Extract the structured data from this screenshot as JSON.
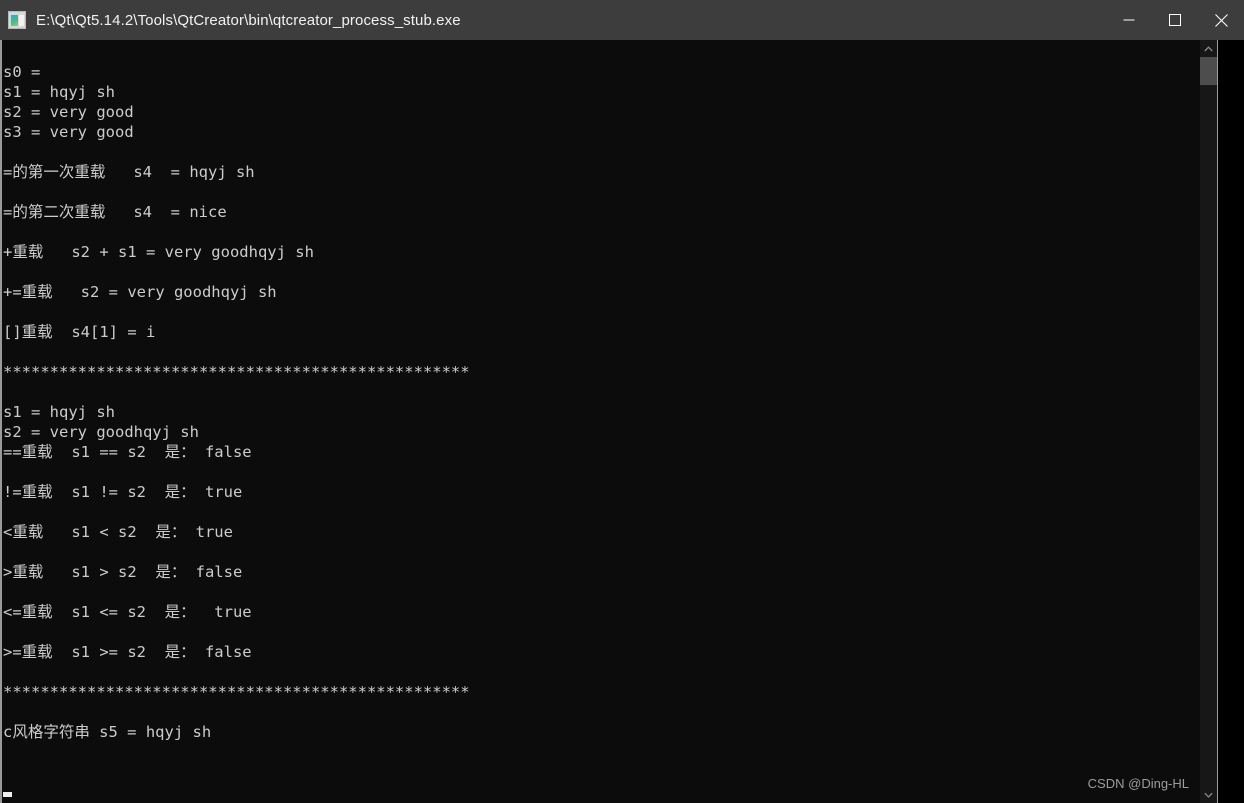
{
  "window": {
    "title": "E:\\Qt\\Qt5.14.2\\Tools\\QtCreator\\bin\\qtcreator_process_stub.exe",
    "icon": "console-window-icon",
    "titlebar_color": "#3d3d3d",
    "background_color": "#0c0c0c",
    "text_color": "#cccccc",
    "controls": {
      "minimize_label": "—",
      "maximize_label": "□",
      "close_label": "✕"
    }
  },
  "scrollbar": {
    "up_arrow": "chevron-up-icon",
    "down_arrow": "chevron-down-icon",
    "thumb_color": "#4d4d4d",
    "track_color": "#171717"
  },
  "console": {
    "lines": [
      "s0 = ",
      "s1 = hqyj sh",
      "s2 = very good",
      "s3 = very good",
      "",
      "=的第一次重载   s4  = hqyj sh",
      "",
      "=的第二次重载   s4  = nice",
      "",
      "+重载   s2 + s1 = very goodhqyj sh",
      "",
      "+=重载   s2 = very goodhqyj sh",
      "",
      "[]重载  s4[1] = i",
      "",
      "**************************************************",
      "",
      "s1 = hqyj sh",
      "s2 = very goodhqyj sh",
      "==重载  s1 == s2  是： false",
      "",
      "!=重载  s1 != s2  是： true",
      "",
      "<重载   s1 < s2  是： true",
      "",
      ">重载   s1 > s2  是： false",
      "",
      "<=重载  s1 <= s2  是：  true",
      "",
      ">=重载  s1 >= s2  是： false",
      "",
      "**************************************************",
      "",
      "c风格字符串 s5 = hqyj sh",
      "",
      ""
    ]
  },
  "watermark": {
    "text": "CSDN @Ding-HL"
  }
}
